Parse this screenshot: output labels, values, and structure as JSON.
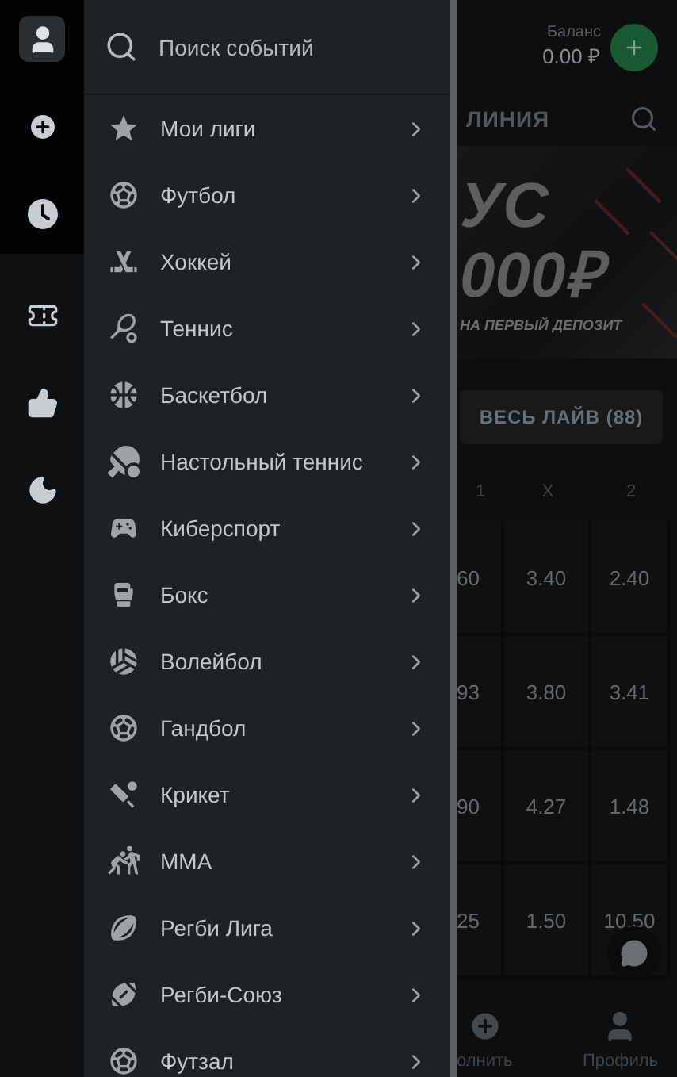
{
  "rail": [
    {
      "selected": true
    },
    {
      "selected": false
    },
    {
      "selected": false
    },
    {
      "selected": false
    },
    {
      "selected": false
    },
    {
      "selected": false
    }
  ],
  "drawer": {
    "search": {
      "placeholder": "Поиск событий"
    },
    "items": [
      {
        "label": "Мои лиги"
      },
      {
        "label": "Футбол"
      },
      {
        "label": "Хоккей"
      },
      {
        "label": "Теннис"
      },
      {
        "label": "Баскетбол"
      },
      {
        "label": "Настольный теннис"
      },
      {
        "label": "Киберспорт"
      },
      {
        "label": "Бокс"
      },
      {
        "label": "Волейбол"
      },
      {
        "label": "Гандбол"
      },
      {
        "label": "Крикет"
      },
      {
        "label": "ММА"
      },
      {
        "label": "Регби Лига"
      },
      {
        "label": "Регби-Союз"
      },
      {
        "label": "Футзал"
      }
    ]
  },
  "background": {
    "balance": {
      "label": "Баланс",
      "value": "0.00 ₽"
    },
    "tab": "ЛИНИЯ",
    "banner": {
      "line_1": "УС",
      "line_2": "000₽",
      "caption": "НА ПЕРВЫЙ ДЕПОЗИТ"
    },
    "live_button": "ВЕСЬ ЛАЙВ (88)",
    "columns": [
      "1",
      "X",
      "2"
    ],
    "rows": [
      [
        "60",
        "3.40",
        "2.40"
      ],
      [
        "93",
        "3.80",
        "3.41"
      ],
      [
        "90",
        "4.27",
        "1.48"
      ],
      [
        "25",
        "1.50",
        "10.50"
      ]
    ],
    "nav": [
      {
        "label": "олнить"
      },
      {
        "label": "Профиль"
      }
    ]
  }
}
